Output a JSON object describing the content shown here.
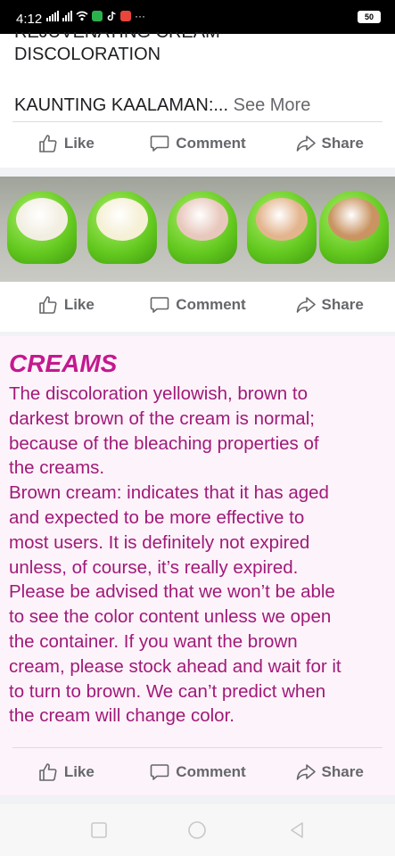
{
  "status_bar": {
    "time": "4:12",
    "more": "···",
    "battery": "50"
  },
  "post_top": {
    "cut_line": "REJUVENATING CREAM",
    "line1": "DISCOLORATION",
    "line2": "KAUNTING KAALAMAN:...",
    "see_more": "See More"
  },
  "actions": {
    "like": "Like",
    "comment": "Comment",
    "share": "Share"
  },
  "photo": {
    "jar_colors": [
      "#f2efe2",
      "#f5f0d6",
      "#e8c8bd",
      "#e3b58e",
      "#c99462"
    ]
  },
  "creams": {
    "title": "CREAMS",
    "lines": [
      "The discoloration yellowish, brown to",
      "darkest brown of the  cream is normal;",
      "because of the bleaching properties of",
      "the creams.",
      "Brown cream: indicates that it has aged",
      "and expected to be more effective to",
      "most users. It is definitely not expired",
      "unless, of course, it’s really expired.",
      "Please be advised that we won’t be able",
      "to see the color content unless we open",
      "the container. If you want the brown",
      "cream, please stock ahead and wait for it",
      "to turn to brown. We can’t predict when",
      "the cream will change color."
    ]
  },
  "colors": {
    "creams_title": "#c3198f",
    "creams_text": "#a01a78",
    "action_grey": "#65676b"
  }
}
